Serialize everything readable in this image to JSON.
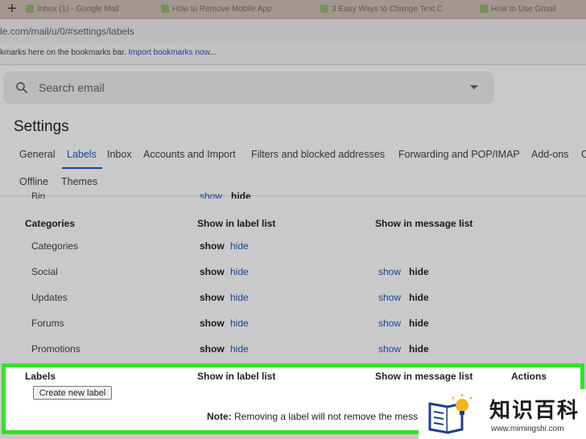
{
  "browser": {
    "tabs": [
      {
        "label": "Inbox (1) - Google Mail"
      },
      {
        "label": "How to Remove Mobile App"
      },
      {
        "label": "3 Easy Ways to Change Text C"
      },
      {
        "label": "How to Use Gmail"
      }
    ],
    "url_visible": "le.com/mail/u/0/#settings/labels",
    "bookmarks_text": "kmarks here on the bookmarks bar.",
    "bookmarks_link": "Import bookmarks now..."
  },
  "search": {
    "placeholder": "Search email"
  },
  "settings": {
    "title": "Settings",
    "tabs_row1": [
      "General",
      "Labels",
      "Inbox",
      "Accounts and Import",
      "Filters and blocked addresses",
      "Forwarding and POP/IMAP",
      "Add-ons",
      "C"
    ],
    "tabs_row2": [
      "Offline",
      "Themes"
    ],
    "active_tab": "Labels"
  },
  "partial_row": {
    "name": "Bin",
    "show": "show",
    "hide": "hide"
  },
  "categories_header": {
    "section": "Categories",
    "col_label_list": "Show in label list",
    "col_message_list": "Show in message list"
  },
  "category_rows": [
    {
      "name": "Categories",
      "label_show": "show",
      "label_hide": "hide",
      "msg_show": "",
      "msg_hide": ""
    },
    {
      "name": "Social",
      "label_show": "show",
      "label_hide": "hide",
      "msg_show": "show",
      "msg_hide": "hide"
    },
    {
      "name": "Updates",
      "label_show": "show",
      "label_hide": "hide",
      "msg_show": "show",
      "msg_hide": "hide"
    },
    {
      "name": "Forums",
      "label_show": "show",
      "label_hide": "hide",
      "msg_show": "show",
      "msg_hide": "hide"
    },
    {
      "name": "Promotions",
      "label_show": "show",
      "label_hide": "hide",
      "msg_show": "show",
      "msg_hide": "hide"
    }
  ],
  "labels_section": {
    "section": "Labels",
    "col_label_list": "Show in label list",
    "col_message_list": "Show in message list",
    "col_actions": "Actions",
    "create_button": "Create new label",
    "note_bold": "Note:",
    "note_text": " Removing a label will not remove the mess"
  },
  "watermark": {
    "title": "知识百科",
    "url": "www.mimingshi.com"
  },
  "colors": {
    "highlight": "#36e02b",
    "link": "#1a56b8"
  }
}
